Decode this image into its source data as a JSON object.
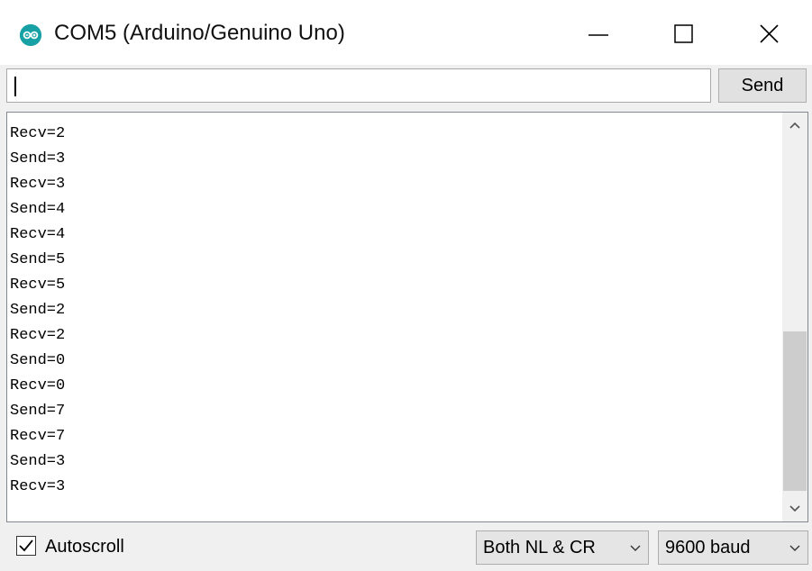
{
  "window": {
    "title": "COM5 (Arduino/Genuino Uno)",
    "icon": "arduino-logo-icon",
    "controls": [
      "minimize-icon",
      "maximize-icon",
      "close-icon"
    ]
  },
  "input": {
    "value": "",
    "send_label": "Send"
  },
  "output": {
    "lines": [
      "Recv=2",
      "Send=3",
      "Recv=3",
      "Send=4",
      "Recv=4",
      "Send=5",
      "Recv=5",
      "Send=2",
      "Recv=2",
      "Send=0",
      "Recv=0",
      "Send=7",
      "Recv=7",
      "Send=3",
      "Recv=3"
    ]
  },
  "footer": {
    "autoscroll_label": "Autoscroll",
    "autoscroll_checked": true,
    "line_ending_selected": "Both NL & CR",
    "baud_selected": "9600 baud"
  },
  "colors": {
    "arduino_teal": "#17a1a5",
    "window_bg": "#f0f0f0",
    "scroll_thumb": "#cdcdcd"
  }
}
